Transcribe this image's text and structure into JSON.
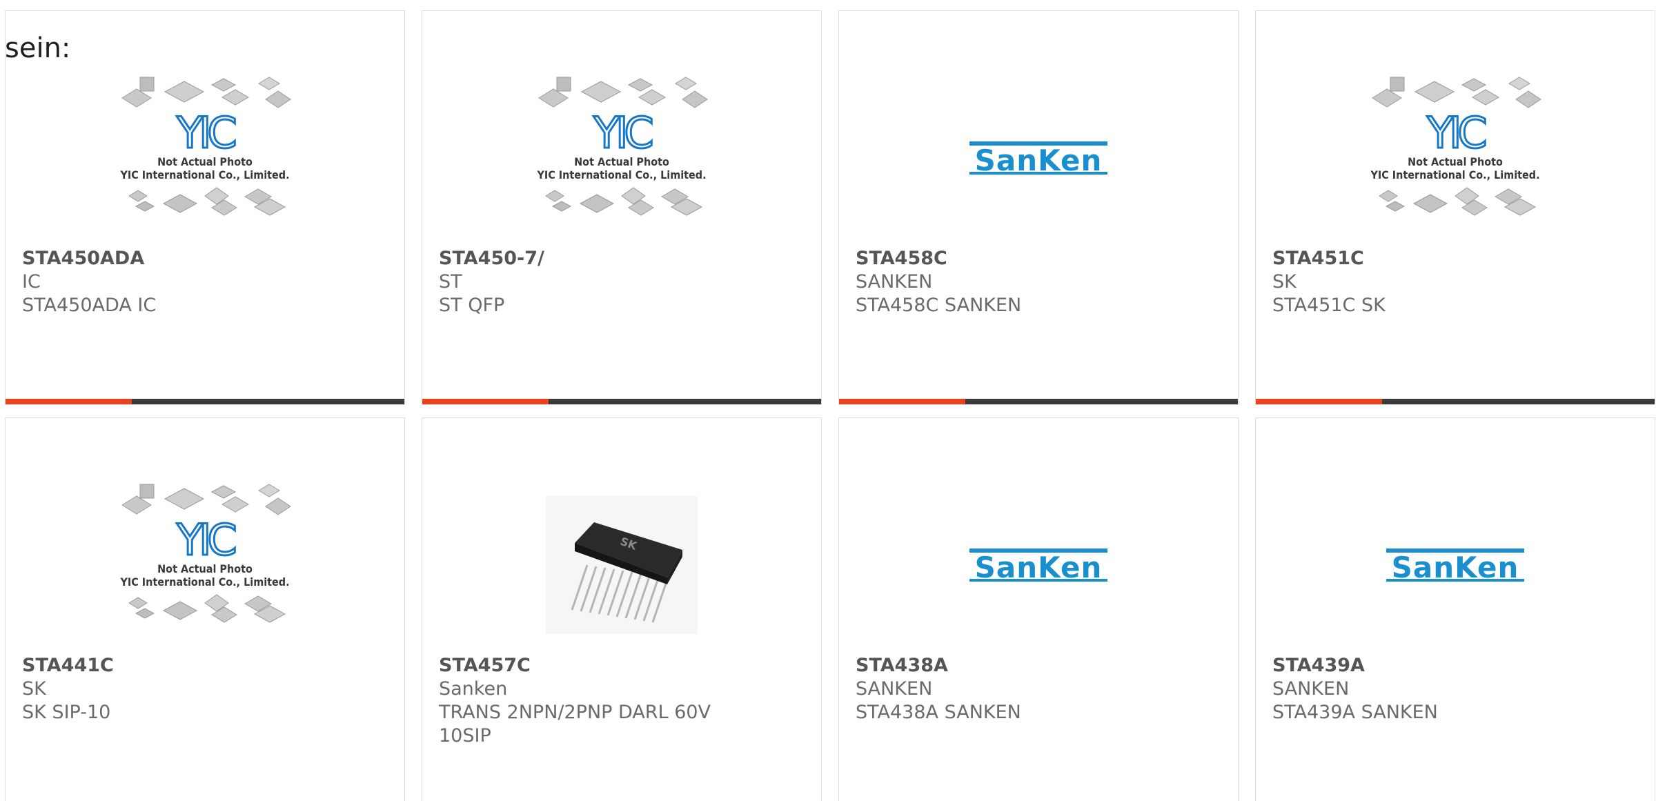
{
  "intro_text": "sein:",
  "colors": {
    "accent": "#e8431c",
    "bar": "#3a3a3a",
    "sanken_blue": "#1a8fd0",
    "yic_blue": "#1677c7"
  },
  "products": [
    {
      "part_number": "STA450ADA",
      "manufacturer": "IC",
      "description": "STA450ADA IC",
      "image": "yic-placeholder",
      "image_caption_line1": "Not Actual Photo",
      "image_caption_line2": "YIC International Co., Limited."
    },
    {
      "part_number": "STA450-7/",
      "manufacturer": "ST",
      "description": "ST QFP",
      "image": "yic-placeholder",
      "image_caption_line1": "Not Actual Photo",
      "image_caption_line2": "YIC International Co., Limited."
    },
    {
      "part_number": "STA458C",
      "manufacturer": "SANKEN",
      "description": "STA458C SANKEN",
      "image": "sanken-logo",
      "logo_text": "SanKen"
    },
    {
      "part_number": "STA451C",
      "manufacturer": "SK",
      "description": "STA451C SK",
      "image": "yic-placeholder",
      "image_caption_line1": "Not Actual Photo",
      "image_caption_line2": "YIC International Co., Limited."
    },
    {
      "part_number": "STA441C",
      "manufacturer": "SK",
      "description": "SK SIP-10",
      "image": "yic-placeholder",
      "image_caption_line1": "Not Actual Photo",
      "image_caption_line2": "YIC International Co., Limited."
    },
    {
      "part_number": "STA457C",
      "manufacturer": "Sanken",
      "description": "TRANS 2NPN/2PNP DARL 60V 10SIP",
      "image": "sip-chip-photo",
      "chip_mark": "SK"
    },
    {
      "part_number": "STA438A",
      "manufacturer": "SANKEN",
      "description": "STA438A SANKEN",
      "image": "sanken-logo",
      "logo_text": "SanKen"
    },
    {
      "part_number": "STA439A",
      "manufacturer": "SANKEN",
      "description": "STA439A SANKEN",
      "image": "sanken-logo",
      "logo_text": "SanKen"
    }
  ]
}
